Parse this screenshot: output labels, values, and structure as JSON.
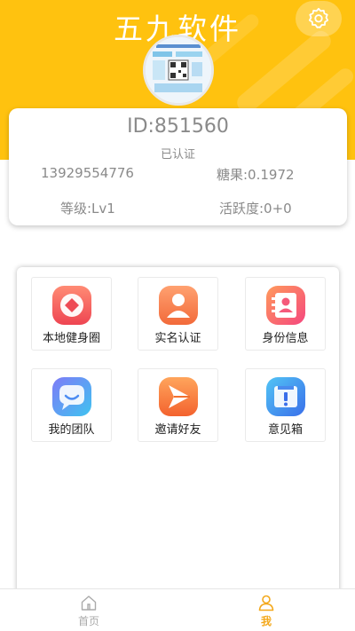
{
  "header": {
    "title": "五九软件",
    "settings_icon": "gear-icon",
    "avatar_icon": "qr-code-avatar-icon",
    "accent_color": "#FFC20F"
  },
  "profile": {
    "id_text": "ID:851560",
    "verified_text": "已认证",
    "phone": "13929554776",
    "candy": "糖果:0.1972",
    "level": "等级:Lv1",
    "activity": "活跃度:0+0"
  },
  "menu": {
    "items": [
      {
        "label": "本地健身圈",
        "icon": "local-fitness-icon",
        "color": "#F5655A"
      },
      {
        "label": "实名认证",
        "icon": "real-name-icon",
        "color": "#F67F45"
      },
      {
        "label": "身份信息",
        "icon": "identity-info-icon",
        "color": "#F7587A"
      },
      {
        "label": "我的团队",
        "icon": "team-icon",
        "color": "#4FA9F6"
      },
      {
        "label": "邀请好友",
        "icon": "invite-friend-icon",
        "color": "#F4782E"
      },
      {
        "label": "意见箱",
        "icon": "feedback-box-icon",
        "color": "#3F86F0"
      }
    ]
  },
  "nav": {
    "home_label": "首页",
    "me_label": "我",
    "active": "我",
    "active_color": "#F3A81B"
  }
}
